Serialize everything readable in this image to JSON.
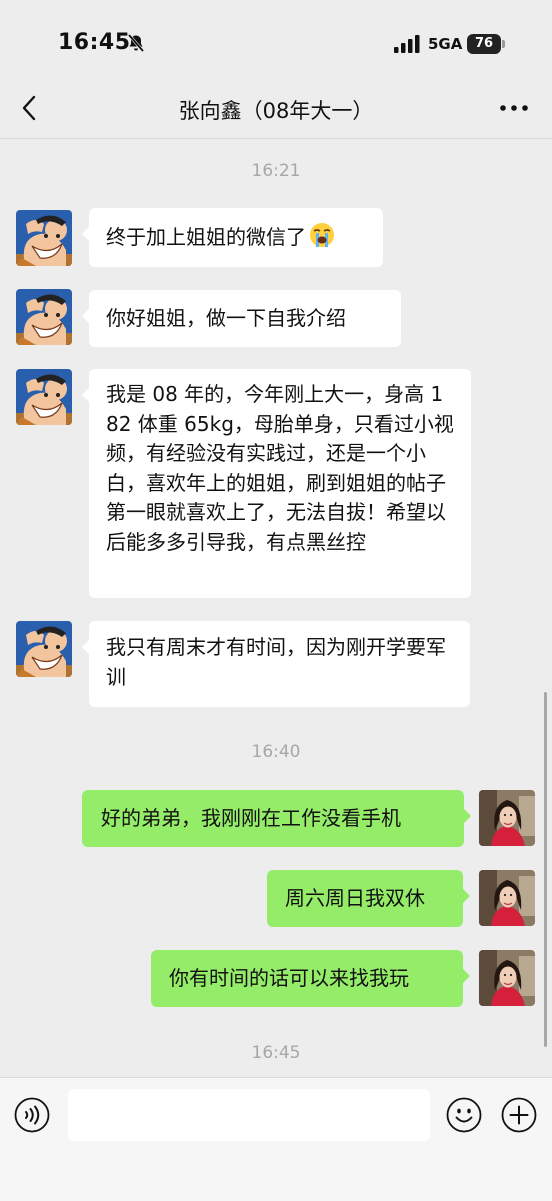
{
  "status_bar": {
    "time": "16:45",
    "network": "5GA",
    "battery": "76"
  },
  "header": {
    "title": "张向鑫（08年大一）"
  },
  "icons": {
    "back": "chevron-left-icon",
    "more": "more-dots-icon",
    "mute": "bell-slash-icon",
    "voice": "voice-icon",
    "emoji": "emoji-icon",
    "plus": "plus-icon"
  },
  "messages": {
    "ts1": "16:21",
    "m1": "终于加上姐姐的微信了",
    "m1_emoji": "loudly-crying-face",
    "m2": "你好姐姐，做一下自我介绍",
    "m3": "我是 08 年的，今年刚上大一，身高 182 体重 65kg，母胎单身，只看过小视频，有经验没有实践过，还是一个小白，喜欢年上的姐姐，刷到姐姐的帖子第一眼就喜欢上了，无法自拔！希望以后能多多引导我，有点黑丝控",
    "m4": "我只有周末才有时间，因为刚开学要军训",
    "ts2": "16:40",
    "m5": "好的弟弟，我刚刚在工作没看手机",
    "m6": "周六周日我双休",
    "m7": "你有时间的话可以来找我玩",
    "ts3": "16:45"
  },
  "input": {
    "value": ""
  },
  "colors": {
    "background": "#ededed",
    "incoming_bubble": "#ffffff",
    "outgoing_bubble": "#95ec69",
    "timestamp": "#a7a7a7"
  }
}
